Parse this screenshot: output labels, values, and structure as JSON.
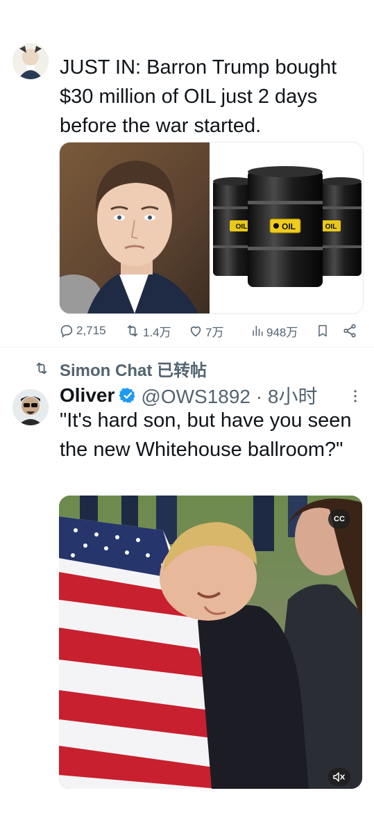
{
  "tweet1": {
    "text": "JUST IN: Barron Trump bought $30 million of OIL just 2 days before the war started.",
    "barrel_label": "OIL",
    "actions": {
      "replies": "2,715",
      "reposts": "1.4万",
      "likes": "7万",
      "views": "948万"
    }
  },
  "tweet2": {
    "retweeted_by": "Simon Chat 已转帖",
    "author_name": "Oliver",
    "handle_time": "@OWS1892 · 8小时",
    "text": "\"It's hard son, but have you seen the new Whitehouse ballroom?\"",
    "video_badges": {
      "captions": "CC"
    }
  },
  "colors": {
    "text_primary": "#0f1419",
    "text_secondary": "#536471",
    "verified_blue": "#1d9bf0",
    "divider": "#eff3f4"
  },
  "icons": [
    "reply-icon",
    "repost-icon",
    "like-icon",
    "views-icon",
    "bookmark-icon",
    "share-icon",
    "retweet-icon",
    "verified-badge-icon",
    "more-icon",
    "mute-icon"
  ]
}
